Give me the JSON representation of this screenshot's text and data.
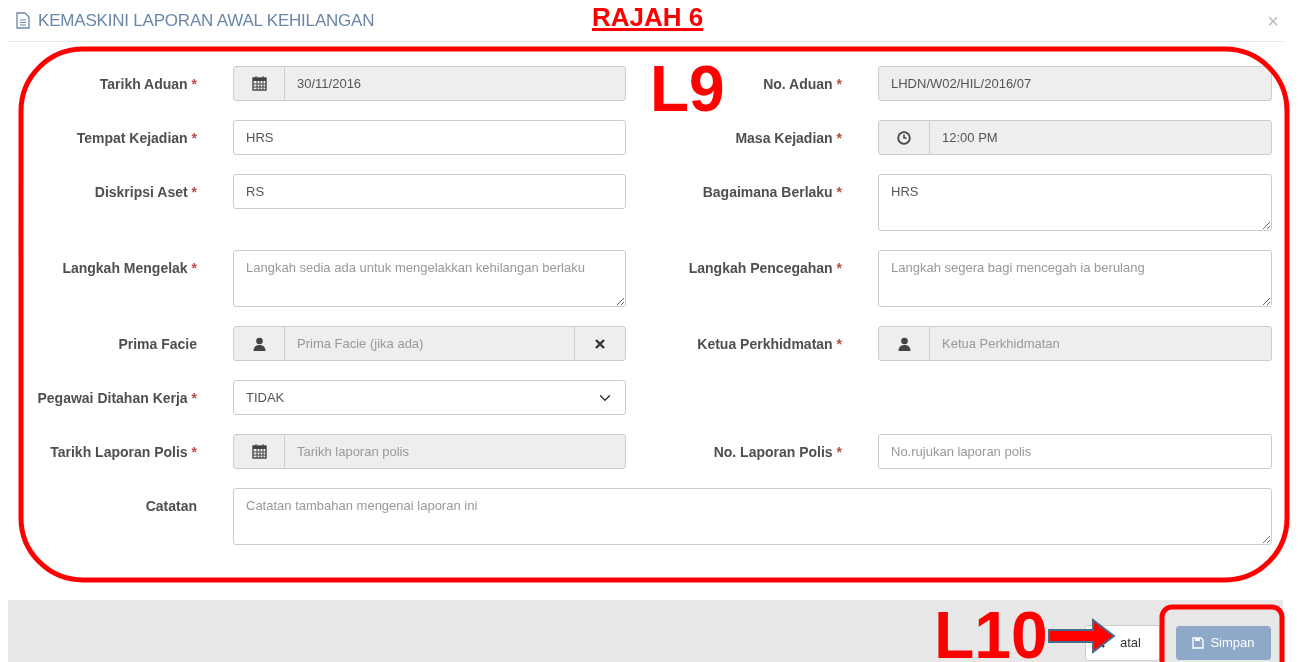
{
  "modal": {
    "title": "KEMASKINI LAPORAN AWAL KEHILANGAN",
    "close": "×"
  },
  "fields": [
    {
      "label": "Tarikh Aduan",
      "required_mark": "*",
      "kind": "date",
      "value": "30/11/2016",
      "disabled": true
    },
    {
      "label": "No. Aduan",
      "required_mark": "*",
      "kind": "text",
      "value": "LHDN/W02/HIL/2016/07",
      "disabled": true
    },
    {
      "label": "Tempat Kejadian",
      "required_mark": "*",
      "kind": "text",
      "value": "HRS",
      "disabled": false
    },
    {
      "label": "Masa Kejadian",
      "required_mark": "*",
      "kind": "time",
      "value": "12:00 PM",
      "disabled": true
    },
    {
      "label": "Diskripsi Aset",
      "required_mark": "*",
      "kind": "text",
      "value": "RS",
      "disabled": false
    },
    {
      "label": "Bagaimana Berlaku",
      "required_mark": "*",
      "kind": "textarea",
      "value": "HRS",
      "disabled": false
    },
    {
      "label": "Langkah Mengelak",
      "required_mark": "*",
      "kind": "textarea",
      "placeholder": "Langkah sedia ada untuk mengelakkan kehilangan berlaku",
      "disabled": false
    },
    {
      "label": "Langkah Pencegahan",
      "required_mark": "*",
      "kind": "textarea",
      "placeholder": "Langkah segera bagi mencegah ia berulang",
      "disabled": false
    },
    {
      "label": "Prima Facie",
      "kind": "person",
      "placeholder": "Prima Facie (jika ada)",
      "disabled": true,
      "clearable": true
    },
    {
      "label": "Ketua Perkhidmatan",
      "required_mark": "*",
      "kind": "person",
      "placeholder": "Ketua Perkhidmatan",
      "disabled": true
    },
    {
      "label": "Pegawai Ditahan Kerja",
      "required_mark": "*",
      "kind": "select",
      "value": "TIDAK",
      "disabled": false
    },
    {
      "kind": "empty"
    },
    {
      "label": "Tarikh Laporan Polis",
      "required_mark": "*",
      "kind": "date",
      "placeholder": "Tarikh laporan polis",
      "disabled": true
    },
    {
      "label": "No. Laporan Polis",
      "required_mark": "*",
      "kind": "text",
      "placeholder": "No.rujukan laporan polis",
      "disabled": false
    },
    {
      "label": "Catatan",
      "kind": "textarea",
      "wide": true,
      "placeholder": "Catatan tambahan mengenai laporan ini",
      "disabled": false
    }
  ],
  "footer": {
    "buttons": [
      {
        "label": "atal",
        "kind": "cancel",
        "disabled": false
      },
      {
        "label": "Simpan",
        "kind": "save",
        "disabled": true
      }
    ]
  },
  "annotations": {
    "caption": "RAJAH 6",
    "labels": [
      "L9",
      "L10"
    ]
  }
}
